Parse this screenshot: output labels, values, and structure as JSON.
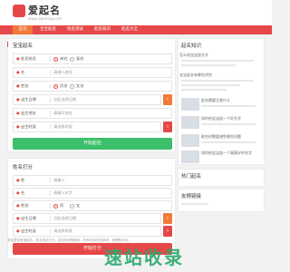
{
  "header": {
    "logo_text": "爱起名",
    "logo_url": "www.izqiming.com"
  },
  "nav": {
    "items": [
      {
        "label": "首页"
      },
      {
        "label": "宝宝起名"
      },
      {
        "label": "姓名测试"
      },
      {
        "label": "起名知识"
      },
      {
        "label": "起名大全"
      }
    ]
  },
  "baby_form": {
    "title": "宝宝起名",
    "surname": {
      "label": "姓氏姓氏",
      "placeholder": "请输入姓氏",
      "opt1": "单姓",
      "opt2": "复姓"
    },
    "given": {
      "label": "名",
      "placeholder": "请输入名字"
    },
    "gender": {
      "label": "性别",
      "opt1": "男孩",
      "opt2": "女孩"
    },
    "birth_date": {
      "label": "出生日期",
      "placeholder": "点此选择日期"
    },
    "birth_place": {
      "label": "出生地址",
      "placeholder": "请填写地址"
    },
    "birth_time": {
      "label": "出生时辰",
      "placeholder": "请选择时辰"
    },
    "submit": "开始起名"
  },
  "test_form": {
    "title": "姓名打分",
    "surname": {
      "label": "姓",
      "placeholder": "请输入"
    },
    "given": {
      "label": "名",
      "placeholder": "请输入名字"
    },
    "gender": {
      "label": "性别",
      "opt1": "男",
      "opt2": "女"
    },
    "birth_date": {
      "label": "出生日期",
      "placeholder": "点此选择日期"
    },
    "birth_place": {
      "label": "出生地址",
      "placeholder": "请填写地址"
    },
    "birth_time": {
      "label": "出生时辰",
      "placeholder": "请选择时辰"
    },
    "submit": "开始打分"
  },
  "sidebar": {
    "title": "起名知识",
    "articles": [
      "怎么给宝宝起名字",
      "宝宝起名有哪些讲究",
      "起名需要注意什么",
      "如何给宝宝起一个好名字",
      "取名时需要避免哪些问题",
      "如何给宝宝起一个寓意好的名字"
    ],
    "section2": "热门起名",
    "section3": "友情链接"
  },
  "footer": {
    "note": "本站提供宝宝起名、姓名测试打分、起名知识等服务，所有内容仅供参考，请理性对待。",
    "brand": "速站收录"
  },
  "colors": {
    "brand_red": "#e54848",
    "accent_orange": "#f07a3a",
    "button_green": "#3cbf6a",
    "watermark_green": "#2aa86e"
  }
}
